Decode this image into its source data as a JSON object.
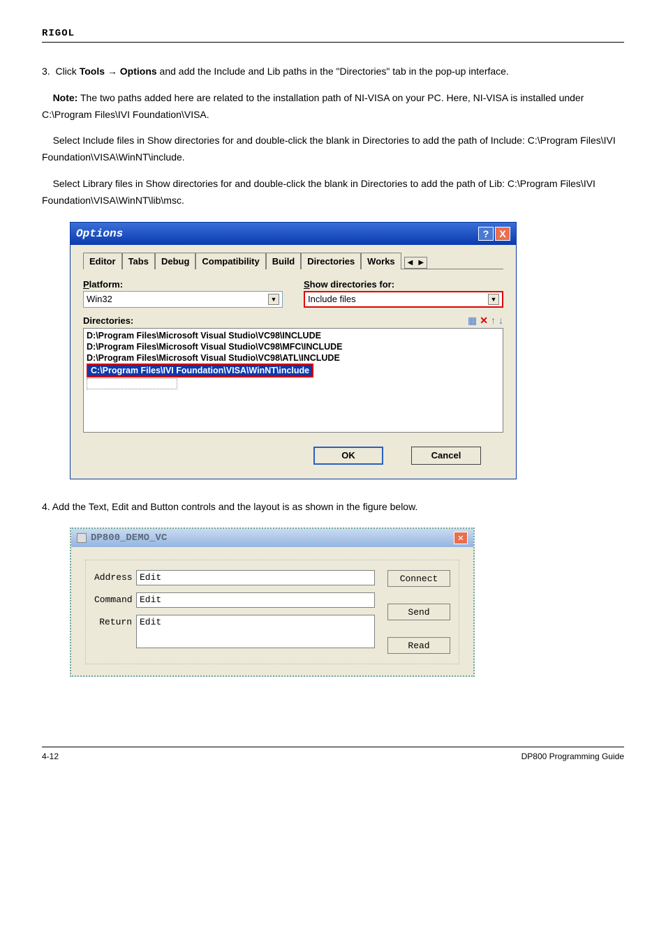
{
  "brand": "RIGOL",
  "doc": {
    "step3_before_arrow": "Click ",
    "step3_tools": "Tools",
    "step3_arrow": " → ",
    "step3_options": "Options",
    "step3_after": " and add the Include and Lib paths in the \"Directories\" tab in the pop-up interface.",
    "note_label": "Note:",
    "note_text": " The two paths added here are related to the installation path of NI-VISA on your PC. Here, NI-VISA is installed under C:\\Program Files\\IVI Foundation\\VISA.",
    "select_include_text": "Select Include files in Show directories for and double-click the blank in Directories to add the path of Include: C:\\Program Files\\IVI Foundation\\VISA\\WinNT\\include.",
    "select_lib_text": "Select Library files in Show directories for and double-click the blank in Directories to add the path of Lib: C:\\Program Files\\IVI Foundation\\VISA\\WinNT\\lib\\msc.",
    "step4_prefix": "4.  ",
    "step4_text": "Add the Text, Edit and Button controls and the layout is as shown in the figure below."
  },
  "options_dialog": {
    "title": "Options",
    "help_btn": "?",
    "close_btn": "X",
    "tabs": [
      "Editor",
      "Tabs",
      "Debug",
      "Compatibility",
      "Build",
      "Directories",
      "Works"
    ],
    "platform_label": "Platform:",
    "platform_value": "Win32",
    "showdirs_label": "Show directories for:",
    "showdirs_value": "Include files",
    "dirs_label": "Directories:",
    "dirs": [
      "D:\\Program Files\\Microsoft Visual Studio\\VC98\\INCLUDE",
      "D:\\Program Files\\Microsoft Visual Studio\\VC98\\MFC\\INCLUDE",
      "D:\\Program Files\\Microsoft Visual Studio\\VC98\\ATL\\INCLUDE"
    ],
    "dir_highlight": "C:\\Program Files\\IVI Foundation\\VISA\\WinNT\\include",
    "ok": "OK",
    "cancel": "Cancel"
  },
  "demo_dialog": {
    "title": "DP800_DEMO_VC",
    "labels": {
      "address": "Address",
      "command": "Command",
      "ret": "Return"
    },
    "input_text": "Edit",
    "buttons": {
      "connect": "Connect",
      "send": "Send",
      "read": "Read"
    }
  },
  "footer": {
    "page": "4-12",
    "right": "DP800 Programming Guide"
  }
}
